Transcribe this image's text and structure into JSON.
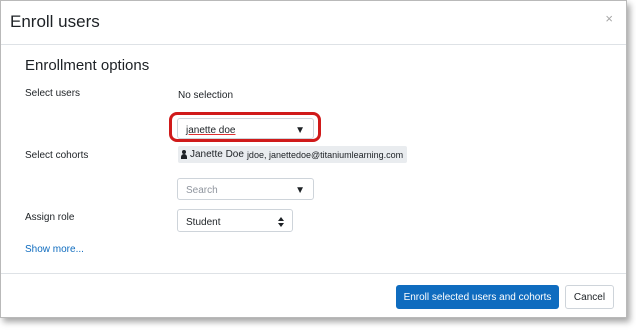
{
  "modal": {
    "title": "Enroll users",
    "close_glyph": "×"
  },
  "section": {
    "title": "Enrollment options"
  },
  "labels": {
    "select_users": "Select users",
    "select_cohorts": "Select cohorts",
    "assign_role": "Assign role"
  },
  "users": {
    "selection_status": "No selection",
    "input_value": "janette doe",
    "suggestion_name": "Janette Doe",
    "suggestion_detail": "jdoe, janettedoe@titaniumlearning.com"
  },
  "cohorts": {
    "placeholder": "Search"
  },
  "role": {
    "selected": "Student"
  },
  "links": {
    "show_more": "Show more..."
  },
  "buttons": {
    "enroll": "Enroll selected users and cohorts",
    "cancel": "Cancel"
  },
  "icons": {
    "caret": "▼",
    "person": "person-icon"
  },
  "colors": {
    "primary": "#0f6cbf",
    "highlight": "#d01a1a",
    "link": "#0f6cbf"
  }
}
